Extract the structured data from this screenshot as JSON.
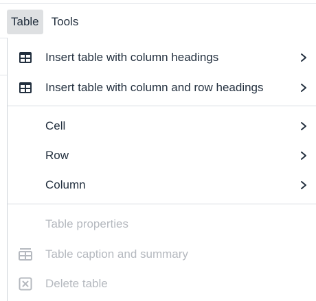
{
  "menubar": {
    "items": [
      {
        "label": "Table",
        "active": true
      },
      {
        "label": "Tools",
        "active": false
      }
    ]
  },
  "menu": {
    "items": [
      {
        "label": "Insert table with column headings",
        "icon": "table-icon",
        "submenu": true,
        "disabled": false
      },
      {
        "label": "Insert table with column and row headings",
        "icon": "table-icon",
        "submenu": true,
        "disabled": false
      },
      {
        "label": "Cell",
        "icon": null,
        "submenu": true,
        "disabled": false
      },
      {
        "label": "Row",
        "icon": null,
        "submenu": true,
        "disabled": false
      },
      {
        "label": "Column",
        "icon": null,
        "submenu": true,
        "disabled": false
      },
      {
        "label": "Table properties",
        "icon": null,
        "submenu": false,
        "disabled": true
      },
      {
        "label": "Table caption and summary",
        "icon": "table-caption-icon",
        "submenu": false,
        "disabled": true
      },
      {
        "label": "Delete table",
        "icon": "delete-table-icon",
        "submenu": false,
        "disabled": true
      }
    ]
  },
  "colors": {
    "text": "#222f3e",
    "disabled_text": "#b5b9bf",
    "active_menubar_bg": "#dee0e2",
    "separator": "#d6dbe0"
  }
}
